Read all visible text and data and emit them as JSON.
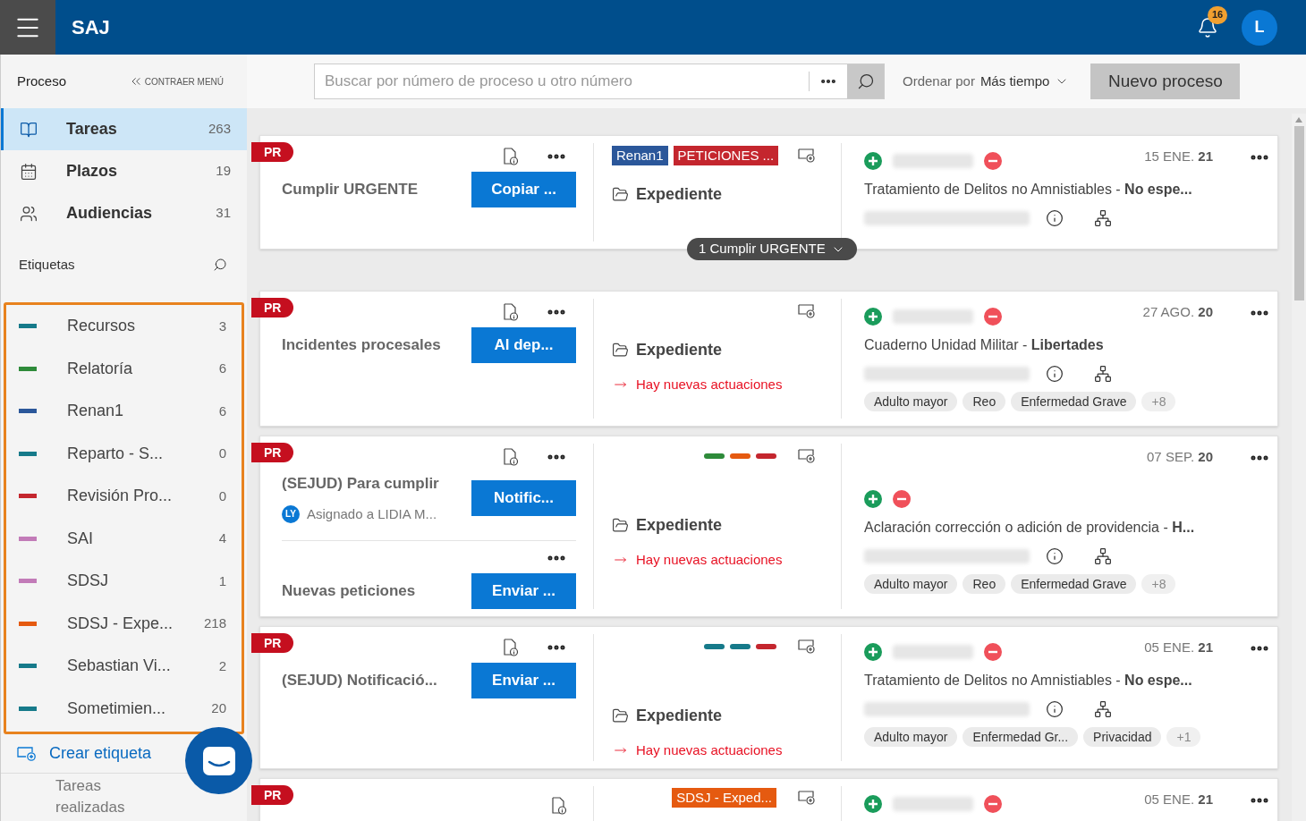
{
  "header": {
    "app_name": "SAJ",
    "notifications": "16",
    "avatar": "L"
  },
  "sidebar": {
    "section_title": "Proceso",
    "collapse": "CONTRAER MENÚ",
    "nav": [
      {
        "kind": "tasks",
        "label": "Tareas",
        "count": "263",
        "selected": true
      },
      {
        "kind": "deadlines",
        "label": "Plazos",
        "count": "19",
        "selected": false
      },
      {
        "kind": "hearings",
        "label": "Audiencias",
        "count": "31",
        "selected": false
      }
    ],
    "tags_title": "Etiquetas",
    "tags": [
      {
        "label": "Recursos",
        "count": "3",
        "color": "#167a8a"
      },
      {
        "label": "Relatoría",
        "count": "6",
        "color": "#2e8b3a"
      },
      {
        "label": "Renan1",
        "count": "6",
        "color": "#2b579a"
      },
      {
        "label": "Reparto - S...",
        "count": "0",
        "color": "#167a8a"
      },
      {
        "label": "Revisión Pro...",
        "count": "0",
        "color": "#c4262e"
      },
      {
        "label": "SAI",
        "count": "4",
        "color": "#c27bb8"
      },
      {
        "label": "SDSJ",
        "count": "1",
        "color": "#c27bb8"
      },
      {
        "label": "SDSJ - Expe...",
        "count": "218",
        "color": "#e55a10"
      },
      {
        "label": "Sebastian Vi...",
        "count": "2",
        "color": "#167a8a"
      },
      {
        "label": "Sometimien...",
        "count": "20",
        "color": "#167a8a"
      }
    ],
    "create_tag": "Crear etiqueta",
    "done": "Tareas realizadas"
  },
  "toolbar": {
    "search": {
      "placeholder": "Buscar por número de proceso u otro número"
    },
    "sort_label": "Ordenar por",
    "sort_value": "Más tiempo",
    "new_button": "Nuevo proceso"
  },
  "cards": [
    {
      "badge": "PR",
      "partial": false,
      "tasks": [
        {
          "title": "Cumplir URGENTE",
          "action": "Copiar ..."
        }
      ],
      "tags": [
        {
          "label": "Renan1",
          "color": "#2b579a"
        },
        {
          "label": "PETICIONES ...",
          "color": "#c4262e"
        }
      ],
      "folder": "Expediente",
      "pill": "1 Cumplir URGENTE",
      "date": "15 ENE.",
      "year": "21",
      "blurred_name": true,
      "subject": "Tratamiento de Delitos no Amnistiables - **No espe...**"
    },
    {
      "badge": "PR",
      "partial": false,
      "tasks": [
        {
          "title": "Incidentes procesales",
          "action": "Al dep..."
        }
      ],
      "folder": "Expediente",
      "news": "Hay nuevas actuaciones",
      "date": "27 AGO.",
      "year": "20",
      "blurred_name": true,
      "subject": "Cuaderno Unidad Militar - **Libertades**",
      "chips": [
        "Adulto mayor",
        "Reo",
        "Enfermedad Grave"
      ],
      "more_chips": "+8"
    },
    {
      "badge": "PR",
      "partial": false,
      "tasks": [
        {
          "title": "(SEJUD) Para cumplir",
          "action": "Notific...",
          "assignee": {
            "initials": "LY",
            "text": "Asignado a LIDIA M..."
          }
        },
        {
          "title": "Nuevas peticiones",
          "action": "Enviar ..."
        }
      ],
      "color_bars": [
        {
          "color": "#2e8b3a"
        },
        {
          "color": "#e55a10"
        },
        {
          "color": "#c4262e"
        }
      ],
      "folder": "Expediente",
      "news": "Hay nuevas actuaciones",
      "date": "07 SEP.",
      "year": "20",
      "blurred_name": false,
      "subject": "Aclaración corrección o adición de providencia - **H...**",
      "chips": [
        "Adulto mayor",
        "Reo",
        "Enfermedad Grave"
      ],
      "more_chips": "+8"
    },
    {
      "badge": "PR",
      "partial": false,
      "tasks": [
        {
          "title": "(SEJUD) Notificació...",
          "action": "Enviar ..."
        }
      ],
      "color_bars": [
        {
          "color": "#167a8a"
        },
        {
          "color": "#167a8a"
        },
        {
          "color": "#c4262e"
        }
      ],
      "folder": "Expediente",
      "news": "Hay nuevas actuaciones",
      "date": "05 ENE.",
      "year": "21",
      "blurred_name": true,
      "subject": "Tratamiento de Delitos no Amnistiables - **No espe...**",
      "chips": [
        "Adulto mayor",
        "Enfermedad Gr...",
        "Privacidad"
      ],
      "more_chips": "+1"
    },
    {
      "badge": "PR",
      "partial": true,
      "tags": [
        {
          "label": "SDSJ - Exped...",
          "color": "#e55a10"
        }
      ],
      "date": "05 ENE.",
      "year": "21",
      "blurred_name": true
    }
  ]
}
